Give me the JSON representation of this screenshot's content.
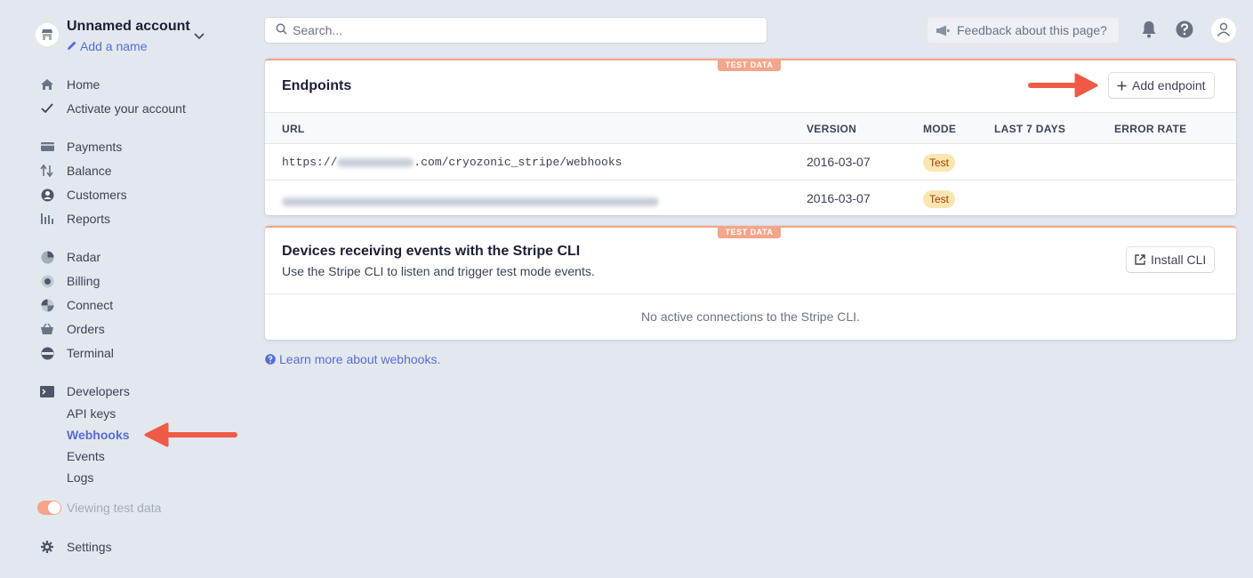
{
  "account": {
    "name": "Unnamed account",
    "add_name": "Add a name"
  },
  "nav": {
    "main": [
      {
        "label": "Home",
        "icon": "home-icon"
      },
      {
        "label": "Activate your account",
        "icon": "check-icon"
      }
    ],
    "products": [
      {
        "label": "Payments",
        "icon": "payments-icon"
      },
      {
        "label": "Balance",
        "icon": "balance-icon"
      },
      {
        "label": "Customers",
        "icon": "customers-icon"
      },
      {
        "label": "Reports",
        "icon": "reports-icon"
      }
    ],
    "extensions": [
      {
        "label": "Radar",
        "icon": "radar-icon"
      },
      {
        "label": "Billing",
        "icon": "billing-icon"
      },
      {
        "label": "Connect",
        "icon": "connect-icon"
      },
      {
        "label": "Orders",
        "icon": "orders-icon"
      },
      {
        "label": "Terminal",
        "icon": "terminal-icon"
      }
    ],
    "developers": {
      "label": "Developers",
      "items": [
        "API keys",
        "Webhooks",
        "Events",
        "Logs"
      ],
      "active": "Webhooks"
    },
    "test_toggle_label": "Viewing test data",
    "test_toggle_on": true,
    "settings": "Settings"
  },
  "topbar": {
    "search_placeholder": "Search...",
    "feedback": "Feedback about this page?"
  },
  "endpoints": {
    "badge": "TEST DATA",
    "title": "Endpoints",
    "add_button": "Add endpoint",
    "columns": [
      "URL",
      "VERSION",
      "MODE",
      "LAST 7 DAYS",
      "ERROR RATE"
    ],
    "rows": [
      {
        "url_prefix": "https://",
        "url_suffix": ".com/cryozonic_stripe/webhooks",
        "version": "2016-03-07",
        "mode": "Test"
      },
      {
        "version": "2016-03-07",
        "mode": "Test"
      }
    ]
  },
  "cli": {
    "badge": "TEST DATA",
    "title": "Devices receiving events with the Stripe CLI",
    "subtitle": "Use the Stripe CLI to listen and trigger test mode events.",
    "install_button": "Install CLI",
    "empty": "No active connections to the Stripe CLI."
  },
  "learn_more": "Learn more about webhooks.",
  "colors": {
    "accent": "#556cd6",
    "test_orange": "#f5a58a",
    "annotation_arrow": "#ef5a45",
    "test_pill_bg": "#fce5b1",
    "test_pill_text": "#a04100"
  }
}
